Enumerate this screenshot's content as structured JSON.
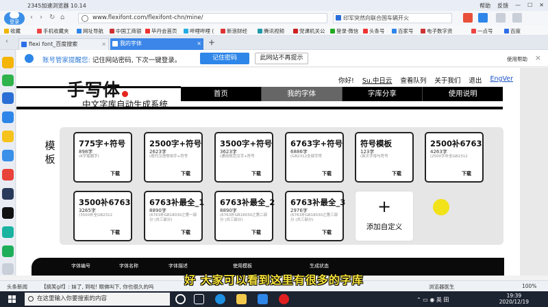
{
  "browser": {
    "title": "2345加速浏览器 10.14",
    "title_right": [
      "帮助",
      "反馈"
    ],
    "login_label": "登录",
    "url": "www.flexifont.com/flexifont-chn/mine/",
    "search_text": "印军突然向联合国车辆开火",
    "bookmarks": [
      "收藏",
      "手机收藏夹",
      "网址导航",
      "中国工商银",
      "毕丹会首页",
      "哔哩哔哩 (",
      "新浪财经",
      "腾讯视频",
      "党课机关公",
      "登录·微信",
      "头条号",
      "百家号",
      "电子数字资",
      "一点号",
      "百度"
    ],
    "tabs": [
      {
        "label": "flexi font_百度搜索"
      },
      {
        "label": "我的字体"
      }
    ]
  },
  "password_bar": {
    "message_prefix": "账号管家提醒您:",
    "message": "记住网站密码, 下次一键登录。",
    "save_label": "记住密码",
    "nosave_label": "此网站不再提示",
    "help": "使用帮助"
  },
  "site": {
    "top_links": [
      "你好!",
      "Su.中日云",
      "查看队列",
      "关于我们",
      "退出",
      "EngVer"
    ],
    "logo": "手写体",
    "subtitle": "中文字库自动生成系统",
    "nav": [
      "首页",
      "我的字体",
      "字库分享",
      "使用说明"
    ],
    "template_label": "模板",
    "templates": [
      {
        "title": "775字+符号",
        "count": "898字",
        "desc": "(8字笔顺字)",
        "action": "下载"
      },
      {
        "title": "2500字+符号",
        "count": "2623字",
        "desc": "(现代汉语常用字+符号",
        "action": "下载"
      },
      {
        "title": "3500字+符号",
        "count": "3623字",
        "desc": "(通用规范汉字+符号",
        "action": "下载"
      },
      {
        "title": "6763字+符号",
        "count": "6886字",
        "desc": "(GB2312全部字符",
        "action": "下载"
      },
      {
        "title": "符号模板",
        "count": "123字",
        "desc": "(英文字母与符号",
        "action": "下载"
      },
      {
        "title": "2500补6763",
        "count": "4263字",
        "desc": "(2500字补全GB2312",
        "action": "下载"
      },
      {
        "title": "3500补6763",
        "count": "3265字",
        "desc": "(3500补全GB2312",
        "action": "下载"
      },
      {
        "title": "6763补最全_1",
        "count": "8890字",
        "desc": "(6763补GB18030之第一部分 (共三部分)",
        "action": "下载"
      },
      {
        "title": "6763补最全_2",
        "count": "8890字",
        "desc": "(6763补GB18030之第二部分 (共三部分)",
        "action": "下载"
      },
      {
        "title": "6763补最全_3",
        "count": "2976字",
        "desc": "(6763补GB18030之第三部分 (共三部分)",
        "action": "下载"
      }
    ],
    "add_custom": "添加自定义",
    "table_headers": [
      "字体编号",
      "字体名称",
      "字体描述",
      "使用模板",
      "生成状态"
    ]
  },
  "subtitle_caption": "好 大家可以看到这里有很多的字库",
  "statusbar": {
    "left": "头条新闻",
    "news": "【搞笑gif】: 妹了, 到啦! 眼佛叫下, 你也很久的吗",
    "right": [
      "浏览器医生",
      "100%"
    ]
  },
  "taskbar": {
    "search_placeholder": "在这里输入你要搜索的内容",
    "time": "19:39",
    "date": "2020/12/19",
    "ime": "英"
  },
  "colors": {
    "accent": "#2e86e8",
    "dark": "#000000",
    "subtitle": "#f6e23a"
  }
}
